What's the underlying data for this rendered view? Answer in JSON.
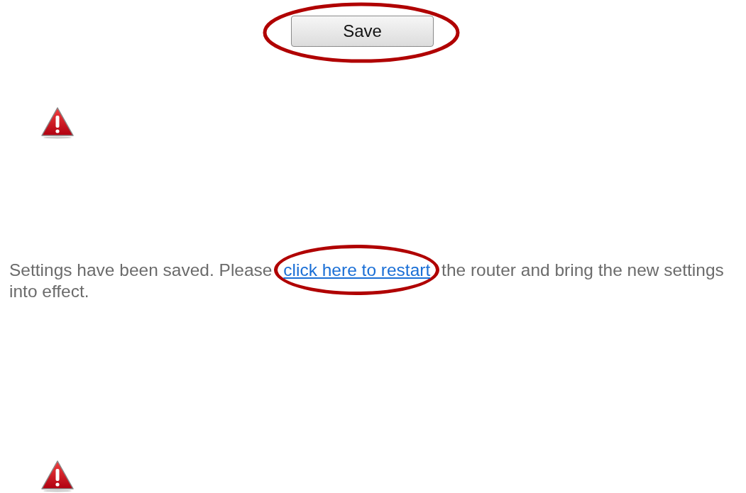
{
  "save_button": {
    "label": "Save"
  },
  "message": {
    "text_before": "Settings have been saved. Please",
    "link": "click here to restart",
    "text_after": "the router and bring the new settings into effect."
  }
}
